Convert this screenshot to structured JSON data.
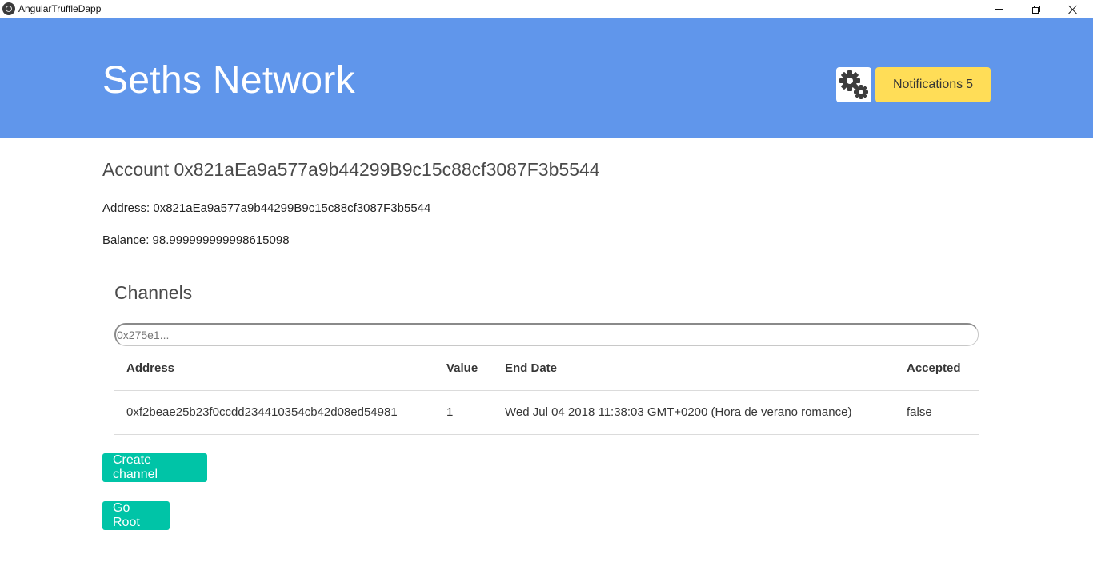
{
  "window": {
    "title": "AngularTruffleDapp"
  },
  "header": {
    "brand": "Seths Network",
    "settings_icon": "gears-icon",
    "notifications_label": "Notifications",
    "notifications_count": "5",
    "colors": {
      "header_bg": "#6096eb",
      "notif_bg": "#ffdd57"
    }
  },
  "account": {
    "title": "Account 0x821aEa9a577a9b44299B9c15c88cf3087F3b5544",
    "address_line": "Address: 0x821aEa9a577a9b44299B9c15c88cf3087F3b5544",
    "balance_line": "Balance: 98.999999999998615098"
  },
  "channels": {
    "title": "Channels",
    "search_placeholder": "0x275e1...",
    "columns": [
      "Address",
      "Value",
      "End Date",
      "Accepted"
    ],
    "rows": [
      {
        "address": "0xf2beae25b23f0ccdd234410354cb42d08ed54981",
        "value": "1",
        "end_date": "Wed Jul 04 2018 11:38:03 GMT+0200 (Hora de verano romance)",
        "accepted": "false"
      }
    ]
  },
  "actions": {
    "create_channel": "Create channel",
    "go_root": "Go Root",
    "button_color": "#00c4a7"
  }
}
